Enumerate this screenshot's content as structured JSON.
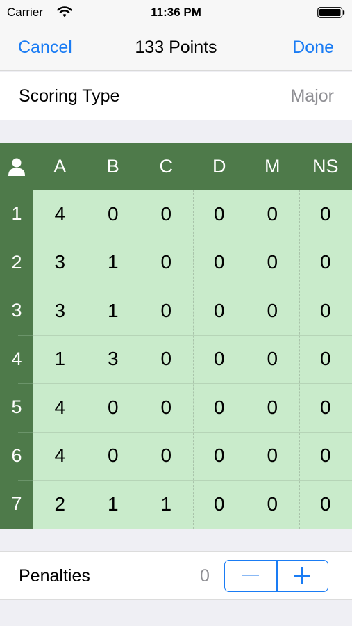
{
  "status_bar": {
    "carrier": "Carrier",
    "time": "11:36 PM",
    "icons": [
      "wifi-icon",
      "battery-icon"
    ]
  },
  "nav": {
    "cancel": "Cancel",
    "title": "133 Points",
    "done": "Done"
  },
  "scoring": {
    "label": "Scoring Type",
    "value": "Major"
  },
  "grid": {
    "header_icon": "person-icon",
    "columns": [
      "A",
      "B",
      "C",
      "D",
      "M",
      "NS"
    ],
    "rows": [
      {
        "label": "1",
        "values": [
          "4",
          "0",
          "0",
          "0",
          "0",
          "0"
        ]
      },
      {
        "label": "2",
        "values": [
          "3",
          "1",
          "0",
          "0",
          "0",
          "0"
        ]
      },
      {
        "label": "3",
        "values": [
          "3",
          "1",
          "0",
          "0",
          "0",
          "0"
        ]
      },
      {
        "label": "4",
        "values": [
          "1",
          "3",
          "0",
          "0",
          "0",
          "0"
        ]
      },
      {
        "label": "5",
        "values": [
          "4",
          "0",
          "0",
          "0",
          "0",
          "0"
        ]
      },
      {
        "label": "6",
        "values": [
          "4",
          "0",
          "0",
          "0",
          "0",
          "0"
        ]
      },
      {
        "label": "7",
        "values": [
          "2",
          "1",
          "1",
          "0",
          "0",
          "0"
        ]
      }
    ]
  },
  "penalties": {
    "label": "Penalties",
    "value": "0"
  },
  "colors": {
    "accent": "#1a7cf4",
    "grid_header": "#4e7a4a",
    "grid_cell": "#c9ebcb"
  }
}
